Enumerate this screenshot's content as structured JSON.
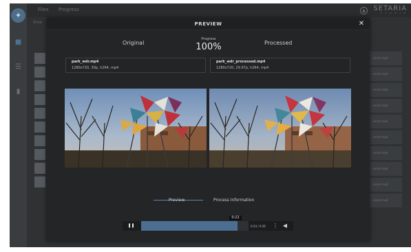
{
  "app": {
    "breadcrumbs": [
      "Files",
      "Progress"
    ],
    "brand": "SETARIA",
    "brand_sub": "S T U D I O",
    "bg_label": "Show",
    "row_labels": [
      "...essed.mp4",
      "...essed.mp4",
      "...essed.mp4",
      "...essed.mp4",
      "...essed.mp4",
      "...essed.mp4",
      "...essed.mp4",
      "...essed.mp4",
      "...essed.mp4",
      "...essed.mp4"
    ]
  },
  "modal": {
    "title": "PREVIEW",
    "original_label": "Original",
    "processed_label": "Processed",
    "progress_label": "Progress",
    "progress_value": "100%",
    "original_file": {
      "name": "park_wdr.mp4",
      "info": "1280x720, 30p, h264, mp4"
    },
    "processed_file": {
      "name": "park_wdr_processed.mp4",
      "info": "1280x720, 29.97p, h264, mp4"
    },
    "tabs": [
      "Preview",
      "Process Information"
    ],
    "active_tab": 0,
    "player": {
      "tooltip": "0:22",
      "time": "0:24 / 0:26",
      "seek_fraction": 0.9,
      "play_icon": "pause-icon",
      "more_icon": "more-vertical-icon",
      "volume_icon": "volume-icon"
    }
  },
  "colors": {
    "accent": "#4b6e92",
    "modal_bg": "#242526"
  }
}
